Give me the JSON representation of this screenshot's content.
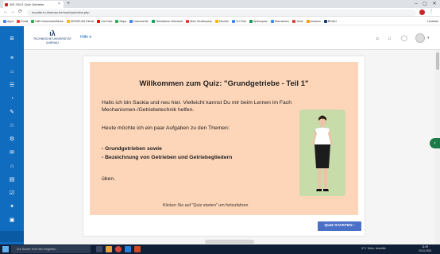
{
  "browser": {
    "tab_title": "WS 20/21 Quiz Getriebe",
    "tab_close": "×",
    "new_tab": "+",
    "minimize": "–",
    "maximize": "▢",
    "close": "✕",
    "back": "←",
    "forward": "→",
    "reload": "⟳",
    "url": "moodle.tu-ilmenau.de/mod/quiz/view.php",
    "bookmarks": [
      {
        "label": "Apps",
        "color": "#4285f4"
      },
      {
        "label": "Email",
        "color": "#ea4335"
      },
      {
        "label": "Hilfe Nutzeroberfläche",
        "color": "#34a853"
      },
      {
        "label": "DEMIPLAN Dienst",
        "color": "#fbbc05"
      },
      {
        "label": "YouTube",
        "color": "#ff0000"
      },
      {
        "label": "Maps",
        "color": "#34a853"
      },
      {
        "label": "Dokumente",
        "color": "#4285f4"
      },
      {
        "label": "Ticketbörse Übersicht",
        "color": "#0f9d58"
      },
      {
        "label": "Mein Studienplan",
        "color": "#db4437"
      },
      {
        "label": "Moodle",
        "color": "#f4b400"
      },
      {
        "label": "TU Club",
        "color": "#4285f4"
      },
      {
        "label": "Speiseplan",
        "color": "#0f9d58"
      },
      {
        "label": "Übersetzen",
        "color": "#4285f4"
      },
      {
        "label": "Tools",
        "color": "#db4437"
      },
      {
        "label": "Amazon",
        "color": "#ff9900"
      },
      {
        "label": "BIGAU",
        "color": "#1a3a6b"
      }
    ],
    "other_bookmarks": "Leseliste"
  },
  "header": {
    "logo_line1": "TECHNISCHE UNIVERSITÄT",
    "logo_line2": "ILMENAU",
    "language": "Hilfe ▾",
    "search_icon": "⌕",
    "bell_icon": "🔔",
    "chat_icon": "💬",
    "avatar_caret": "▾"
  },
  "nav": {
    "icons": [
      "≡",
      "⌂",
      "☰",
      "◔",
      "✎",
      "☆",
      "⚙",
      "✉",
      "⌂",
      "▤",
      "☑",
      "✦",
      "▣"
    ],
    "hamburger": "≡"
  },
  "quiz": {
    "title": "Willkommen zum Quiz: \"Grundgetriebe - Teil 1\"",
    "intro_line1": "Hallo ich bin Saskia und neu hier. Vielleicht kannst Du mir beim Lernen im Fach",
    "intro_line2": "Mechanismen-/Getriebetechnik helfen.",
    "topics_intro": "Heute möchte ich ein paar Aufgaben zu den Themen:",
    "topic1": "- Grundgetrieben sowie",
    "topic2": "- Bezeichnung von Getrieben und Getriebegliedern",
    "topic_end": "üben.",
    "hint": "Klicken Sie auf \"Quiz starten\" um fortzufahren",
    "start_button": "QUIZ STARTEN ›"
  },
  "drawer_toggle": "‹",
  "taskbar": {
    "search_placeholder": "Zur Suche Text hier eingeben",
    "weather": "3°C  Teilw. bewölkt",
    "time": "11:05",
    "date": "10.11.2021"
  }
}
